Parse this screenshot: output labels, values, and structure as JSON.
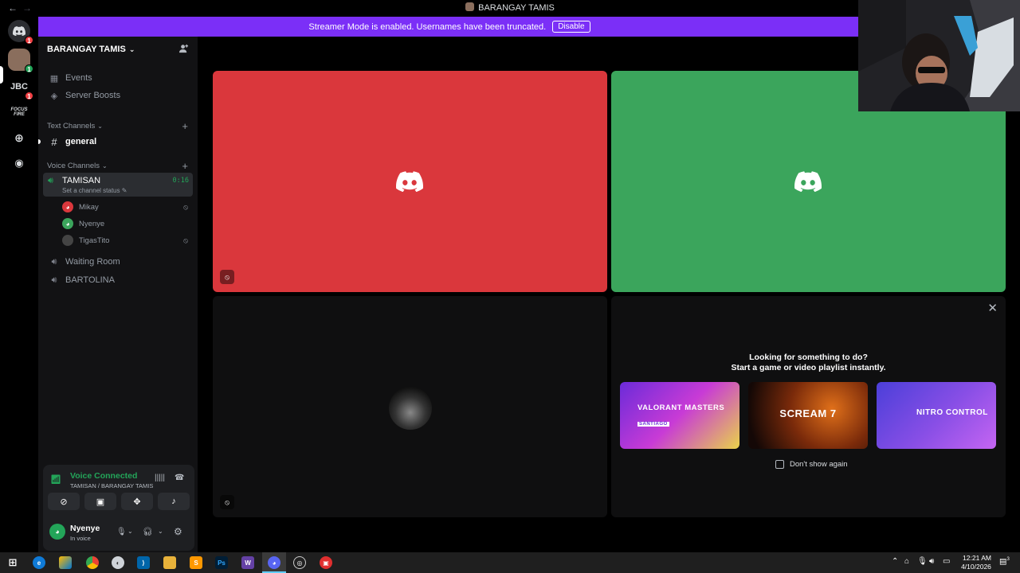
{
  "window": {
    "title": "BARANGAY TAMIS"
  },
  "banner": {
    "text": "Streamer Mode is enabled. Usernames have been truncated.",
    "button": "Disable",
    "color": "#7b2ff7"
  },
  "rail": {
    "jbc_label": "JBC",
    "badge_1": "1",
    "badge_2": "1",
    "badge_3": "1",
    "focus_label": "FOCUS FIRE"
  },
  "sidebar": {
    "guild_name": "BARANGAY TAMIS",
    "events": "Events",
    "boosts": "Server Boosts",
    "text_channels_label": "Text Channels",
    "general": "general",
    "voice_channels_label": "Voice Channels",
    "tamisan": {
      "name": "TAMISAN",
      "status": "Set a channel status",
      "elapsed": "0:16"
    },
    "voice_users": [
      {
        "name": "Mikay",
        "color": "#da373c",
        "muted": true
      },
      {
        "name": "Nyenye",
        "color": "#3ba55c",
        "muted": false
      },
      {
        "name": "TigasTito",
        "color": "#444",
        "muted": true
      }
    ],
    "waiting_room": "Waiting Room",
    "bartolina": "BARTOLINA"
  },
  "voice_panel": {
    "title": "Voice Connected",
    "subtitle": "TAMISAN / BARANGAY TAMIS"
  },
  "user": {
    "name": "Nyenye",
    "status": "In voice"
  },
  "activity": {
    "heading_line1": "Looking for something to do?",
    "heading_line2": "Start a game or video playlist instantly.",
    "cards": [
      {
        "label": "VALORANT MASTERS",
        "sub": "SANTIAGO"
      },
      {
        "label": "SCREAM 7",
        "sub": ""
      },
      {
        "label": "NITRO CONTROL",
        "sub": ""
      }
    ],
    "checkbox_label": "Don't show again"
  },
  "colors": {
    "tile_red": "#da373c",
    "tile_green": "#3ba55c",
    "voice_green": "#23a559"
  },
  "clock": {
    "time": "12:21 AM",
    "date": "4/10/2026"
  },
  "taskbar": {
    "notif_count": "3"
  }
}
